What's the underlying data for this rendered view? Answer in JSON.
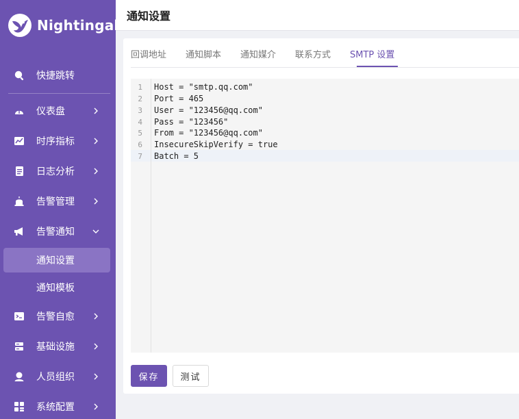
{
  "app": {
    "name": "Nightingale",
    "accent": "#6c53b1"
  },
  "sidebar": {
    "quick": {
      "label": "快捷跳转",
      "icon": "search-icon"
    },
    "items": [
      {
        "label": "仪表盘",
        "icon": "dashboard-icon",
        "chevron": "right"
      },
      {
        "label": "时序指标",
        "icon": "line-chart-icon",
        "chevron": "right"
      },
      {
        "label": "日志分析",
        "icon": "log-icon",
        "chevron": "right"
      },
      {
        "label": "告警管理",
        "icon": "alarm-icon",
        "chevron": "right"
      },
      {
        "label": "告警通知",
        "icon": "megaphone-icon",
        "chevron": "down",
        "children": [
          {
            "label": "通知设置",
            "active": true
          },
          {
            "label": "通知模板",
            "active": false
          }
        ]
      },
      {
        "label": "告警自愈",
        "icon": "terminal-icon",
        "chevron": "right"
      },
      {
        "label": "基础设施",
        "icon": "server-icon",
        "chevron": "right"
      },
      {
        "label": "人员组织",
        "icon": "user-icon",
        "chevron": "right"
      },
      {
        "label": "系统配置",
        "icon": "settings-grid-icon",
        "chevron": "right"
      }
    ]
  },
  "header": {
    "title": "通知设置"
  },
  "tabs": [
    {
      "label": "回调地址",
      "active": false
    },
    {
      "label": "通知脚本",
      "active": false
    },
    {
      "label": "通知媒介",
      "active": false
    },
    {
      "label": "联系方式",
      "active": false
    },
    {
      "label": "SMTP 设置",
      "active": true
    }
  ],
  "editor": {
    "lines": [
      {
        "num": "1",
        "text": "Host = \"smtp.qq.com\""
      },
      {
        "num": "2",
        "text": "Port = 465"
      },
      {
        "num": "3",
        "text": "User = \"123456@qq.com\""
      },
      {
        "num": "4",
        "text": "Pass = \"123456\""
      },
      {
        "num": "5",
        "text": "From = \"123456@qq.com\""
      },
      {
        "num": "6",
        "text": "InsecureSkipVerify = true"
      },
      {
        "num": "7",
        "text": "Batch = 5"
      }
    ],
    "active_line": 7
  },
  "buttons": {
    "save": "保存",
    "test": "测试"
  }
}
